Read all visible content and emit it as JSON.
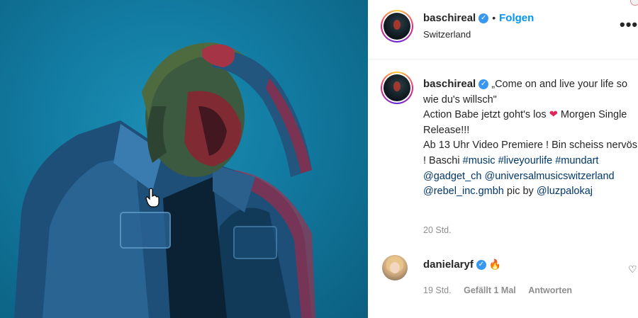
{
  "post": {
    "photo_icon": "person-photo",
    "cursor_icon": "hand-pointer-icon"
  },
  "header": {
    "username": "baschireal",
    "separator": "•",
    "follow_label": "Folgen",
    "location": "Switzerland",
    "more_label": "•••"
  },
  "caption": {
    "username": "baschireal",
    "line1": "„Come on and live your life so wie du's willsch\"",
    "line2_a": "Action Babe jetzt goht's los",
    "heart": "❤",
    "line2_b": "Morgen Single Release!!!",
    "line3": "Ab 13 Uhr Video Premiere ! Bin scheiss nervös ! Baschi",
    "tags": [
      "#music",
      "#liveyourlife",
      "#mundart",
      "@gadget_ch",
      "@universalmusicswitzerland",
      "@rebel_inc.gmbh"
    ],
    "pic_by": "pic by",
    "photographer": "@luzpalokaj",
    "time": "20 Std."
  },
  "comment": {
    "username": "danielaryf",
    "emoji": "🔥",
    "time": "19 Std.",
    "likes": "Gefällt 1 Mal",
    "reply": "Antworten"
  },
  "colors": {
    "accent": "#0095f6",
    "verified": "#3897f0",
    "link": "#00376b",
    "muted": "#8e8e8e",
    "photo_bg": "#127aa0"
  }
}
